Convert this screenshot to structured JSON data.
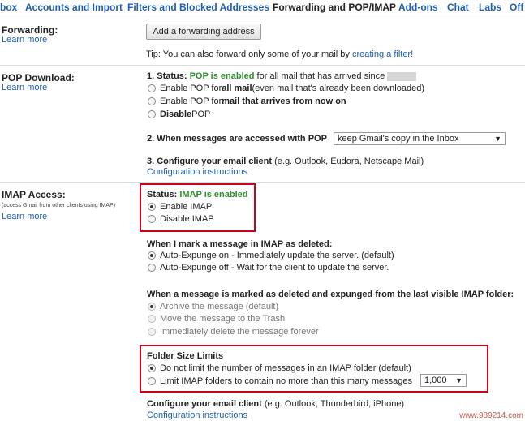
{
  "tabs": [
    "box",
    "Accounts and Import",
    "Filters and Blocked Addresses",
    "Forwarding and POP/IMAP",
    "Add-ons",
    "Chat",
    "Labs",
    "Off"
  ],
  "forwarding": {
    "title": "Forwarding:",
    "learn_more": "Learn more",
    "button": "Add a forwarding address",
    "tip_prefix": "Tip: You can also forward only some of your mail by ",
    "tip_link": "creating a filter!"
  },
  "pop": {
    "title": "POP Download:",
    "learn_more": "Learn more",
    "status_prefix": "1. Status: ",
    "status_value": "POP is enabled",
    "status_suffix": " for all mail that has arrived since",
    "opt1_prefix": "Enable POP for ",
    "opt1_bold": "all mail",
    "opt1_suffix": " (even mail that's already been downloaded)",
    "opt2_prefix": "Enable POP for ",
    "opt2_bold": "mail that arrives from now on",
    "opt3_bold": "Disable",
    "opt3_suffix": " POP",
    "access_label": "2. When messages are accessed with POP",
    "access_select": "keep Gmail's copy in the Inbox",
    "configure_bold": "3. Configure your email client",
    "configure_suffix": " (e.g. Outlook, Eudora, Netscape Mail)",
    "configure_link": "Configuration instructions"
  },
  "imap": {
    "title": "IMAP Access:",
    "note": "(access Gmail from other clients using IMAP)",
    "learn_more": "Learn more",
    "status_prefix": "Status: ",
    "status_value": "IMAP is enabled",
    "enable": "Enable IMAP",
    "disable": "Disable IMAP",
    "deleted_title": "When I mark a message in IMAP as deleted:",
    "expunge_on": "Auto-Expunge on - Immediately update the server. (default)",
    "expunge_off": "Auto-Expunge off - Wait for the client to update the server.",
    "expunged_title": "When a message is marked as deleted and expunged from the last visible IMAP folder:",
    "archive": "Archive the message (default)",
    "trash": "Move the message to the Trash",
    "delete_forever": "Immediately delete the message forever",
    "folder_title": "Folder Size Limits",
    "no_limit": "Do not limit the number of messages in an IMAP folder (default)",
    "limit": "Limit IMAP folders to contain no more than this many messages",
    "limit_value": "1,000",
    "configure_bold": "Configure your email client",
    "configure_suffix": " (e.g. Outlook, Thunderbird, iPhone)",
    "configure_link": "Configuration instructions"
  },
  "watermark": "www.989214.com"
}
